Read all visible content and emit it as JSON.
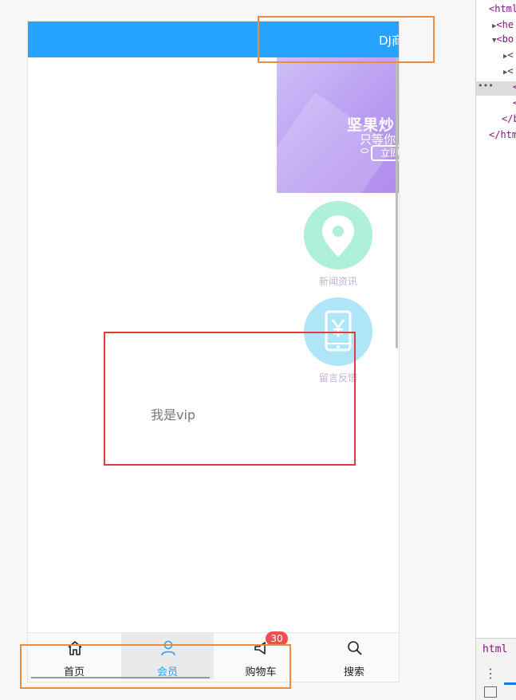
{
  "header": {
    "title": "DJ商"
  },
  "banner": {
    "title": "坚果炒",
    "subtitle": "只等你",
    "button": "立即"
  },
  "grid": [
    {
      "label": "新闻资讯",
      "icon": "location-pin-icon"
    },
    {
      "label": "留言反馈",
      "icon": "phone-yen-icon"
    }
  ],
  "content": {
    "text": "我是vip"
  },
  "tabbar": {
    "items": [
      {
        "label": "首页",
        "icon": "home-icon"
      },
      {
        "label": "会员",
        "icon": "user-icon"
      },
      {
        "label": "购物车",
        "icon": "megaphone-icon",
        "badge": "30"
      },
      {
        "label": "搜索",
        "icon": "search-icon"
      }
    ],
    "active_index": 1
  },
  "devtools": {
    "lines": [
      "<html",
      "<he",
      "<bo",
      "<",
      "<",
      "<",
      "<",
      "</b",
      "</htm"
    ],
    "breadcrumb": "html"
  },
  "colors": {
    "header": "#26a2ff",
    "active_tab": "#26a2ff",
    "badge": "#ef4f4f",
    "annotation_orange": "#ee8a3a",
    "annotation_red": "#e03b3b"
  }
}
